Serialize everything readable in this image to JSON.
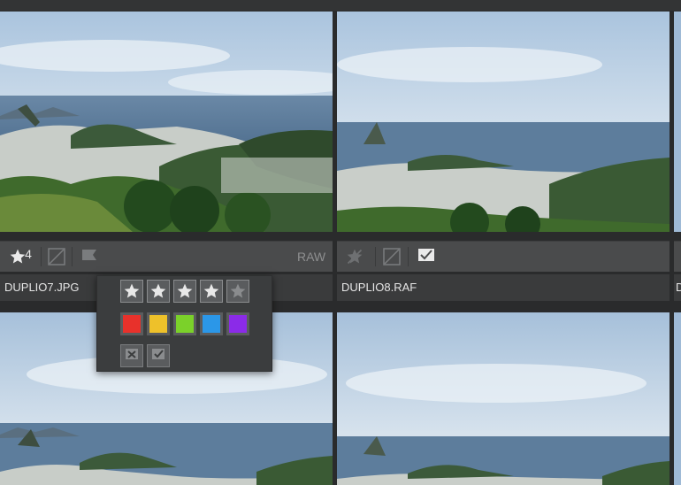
{
  "images": [
    {
      "name": "DUPLIO7.JPG",
      "rating": "4",
      "format": "RAW"
    },
    {
      "name": "DUPLIO8.RAF",
      "rating": "",
      "format": ""
    }
  ],
  "next_column_initial": "D",
  "rating_popup": {
    "stars": 5,
    "colors": [
      "#e8312b",
      "#eec12a",
      "#7bd12a",
      "#2b97e8",
      "#8b2be8"
    ],
    "flags": [
      "reject-flag",
      "pick-flag"
    ]
  },
  "colors": {
    "background": "#2a2b2c",
    "toolbar": "#4a4b4c",
    "namebar": "#3a3b3c"
  }
}
